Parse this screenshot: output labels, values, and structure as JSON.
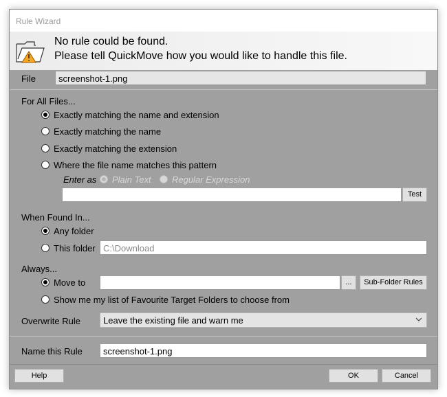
{
  "window": {
    "title": "Rule Wizard"
  },
  "header": {
    "line1": "No rule could be found.",
    "line2": "Please tell QuickMove how you would like to handle this file."
  },
  "file": {
    "label": "File",
    "value": "screenshot-1.png"
  },
  "for_all_files": {
    "heading": "For All Files...",
    "options": [
      "Exactly matching the name and extension",
      "Exactly matching the name",
      "Exactly matching the extension",
      "Where the file name matches this pattern"
    ],
    "selected_index": 0,
    "enter_as_label": "Enter as",
    "enter_as_options": [
      "Plain Text",
      "Regular Expression"
    ],
    "pattern_value": "",
    "test_button": "Test"
  },
  "when_found_in": {
    "heading": "When Found In...",
    "options": [
      "Any folder",
      "This folder"
    ],
    "selected_index": 0,
    "folder_placeholder": "C:\\Download"
  },
  "always": {
    "heading": "Always...",
    "move_to_label": "Move to",
    "move_to_value": "",
    "browse_button": "...",
    "subfolder_button": "Sub-Folder Rules",
    "favourites_label": "Show me my list of Favourite Target Folders to choose from",
    "selected_index": 0
  },
  "overwrite": {
    "label": "Overwrite Rule",
    "selected": "Leave the existing file and warn me"
  },
  "name_rule": {
    "label": "Name this Rule",
    "value": "screenshot-1.png"
  },
  "buttons": {
    "help": "Help",
    "ok": "OK",
    "cancel": "Cancel"
  },
  "icons": {
    "header": "folder-warning-icon",
    "dropdown": "chevron-down-icon"
  },
  "colors": {
    "dialog_bg": "#a0a0a0",
    "warning": "#f5a623"
  }
}
